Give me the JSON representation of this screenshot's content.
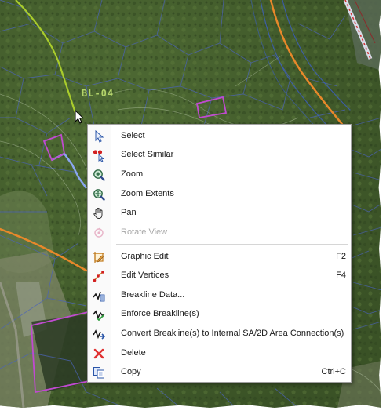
{
  "map": {
    "breakline_label": "BL-04"
  },
  "context_menu": {
    "items": [
      {
        "label": "Select",
        "icon": "cursor-arrow-icon",
        "enabled": true,
        "shortcut": ""
      },
      {
        "label": "Select Similar",
        "icon": "select-similar-icon",
        "enabled": true,
        "shortcut": ""
      },
      {
        "label": "Zoom",
        "icon": "zoom-icon",
        "enabled": true,
        "shortcut": ""
      },
      {
        "label": "Zoom Extents",
        "icon": "zoom-extents-icon",
        "enabled": true,
        "shortcut": ""
      },
      {
        "label": "Pan",
        "icon": "hand-pan-icon",
        "enabled": true,
        "shortcut": ""
      },
      {
        "label": "Rotate View",
        "icon": "rotate-view-icon",
        "enabled": false,
        "shortcut": ""
      },
      {
        "label": "Graphic Edit",
        "icon": "graphic-edit-icon",
        "enabled": true,
        "shortcut": "F2"
      },
      {
        "label": "Edit Vertices",
        "icon": "edit-vertices-icon",
        "enabled": true,
        "shortcut": "F4"
      },
      {
        "label": "Breakline Data...",
        "icon": "breakline-data-icon",
        "enabled": true,
        "shortcut": ""
      },
      {
        "label": "Enforce Breakline(s)",
        "icon": "enforce-breakline-icon",
        "enabled": true,
        "shortcut": ""
      },
      {
        "label": "Convert Breakline(s) to Internal SA/2D Area Connection(s)",
        "icon": "convert-breakline-icon",
        "enabled": true,
        "shortcut": ""
      },
      {
        "label": "Delete",
        "icon": "delete-x-icon",
        "enabled": true,
        "shortcut": ""
      },
      {
        "label": "Copy",
        "icon": "copy-icon",
        "enabled": true,
        "shortcut": "Ctrl+C"
      }
    ]
  }
}
